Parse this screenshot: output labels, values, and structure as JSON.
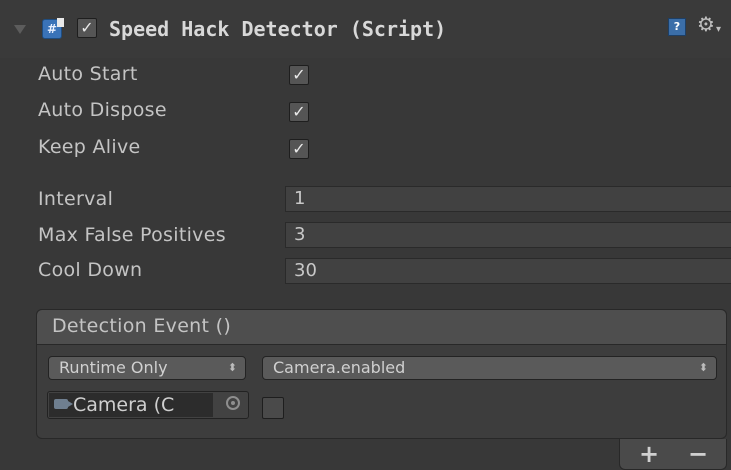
{
  "component": {
    "title": "Speed Hack Detector (Script)",
    "enabled": true,
    "expanded": true
  },
  "toggles": [
    {
      "label": "Auto Start",
      "checked": true
    },
    {
      "label": "Auto Dispose",
      "checked": true
    },
    {
      "label": "Keep Alive",
      "checked": true
    }
  ],
  "fields": [
    {
      "label": "Interval",
      "value": "1"
    },
    {
      "label": "Max False Positives",
      "value": "3"
    },
    {
      "label": "Cool Down",
      "value": "30"
    }
  ],
  "event": {
    "title": "Detection Event ()",
    "runtime_mode": "Runtime Only",
    "function": "Camera.enabled",
    "target_object": "Camera (C",
    "argument_checked": false,
    "add_label": "+",
    "remove_label": "−"
  },
  "icons": {
    "foldout": "foldout-arrow-icon",
    "script": "csharp-script-icon",
    "help": "help-book-icon",
    "settings": "gear-icon",
    "camera": "camera-icon",
    "picker": "object-picker-icon"
  },
  "colors": {
    "background": "#383838",
    "text": "#c4c4c4",
    "script_icon": "#3a73b8"
  }
}
